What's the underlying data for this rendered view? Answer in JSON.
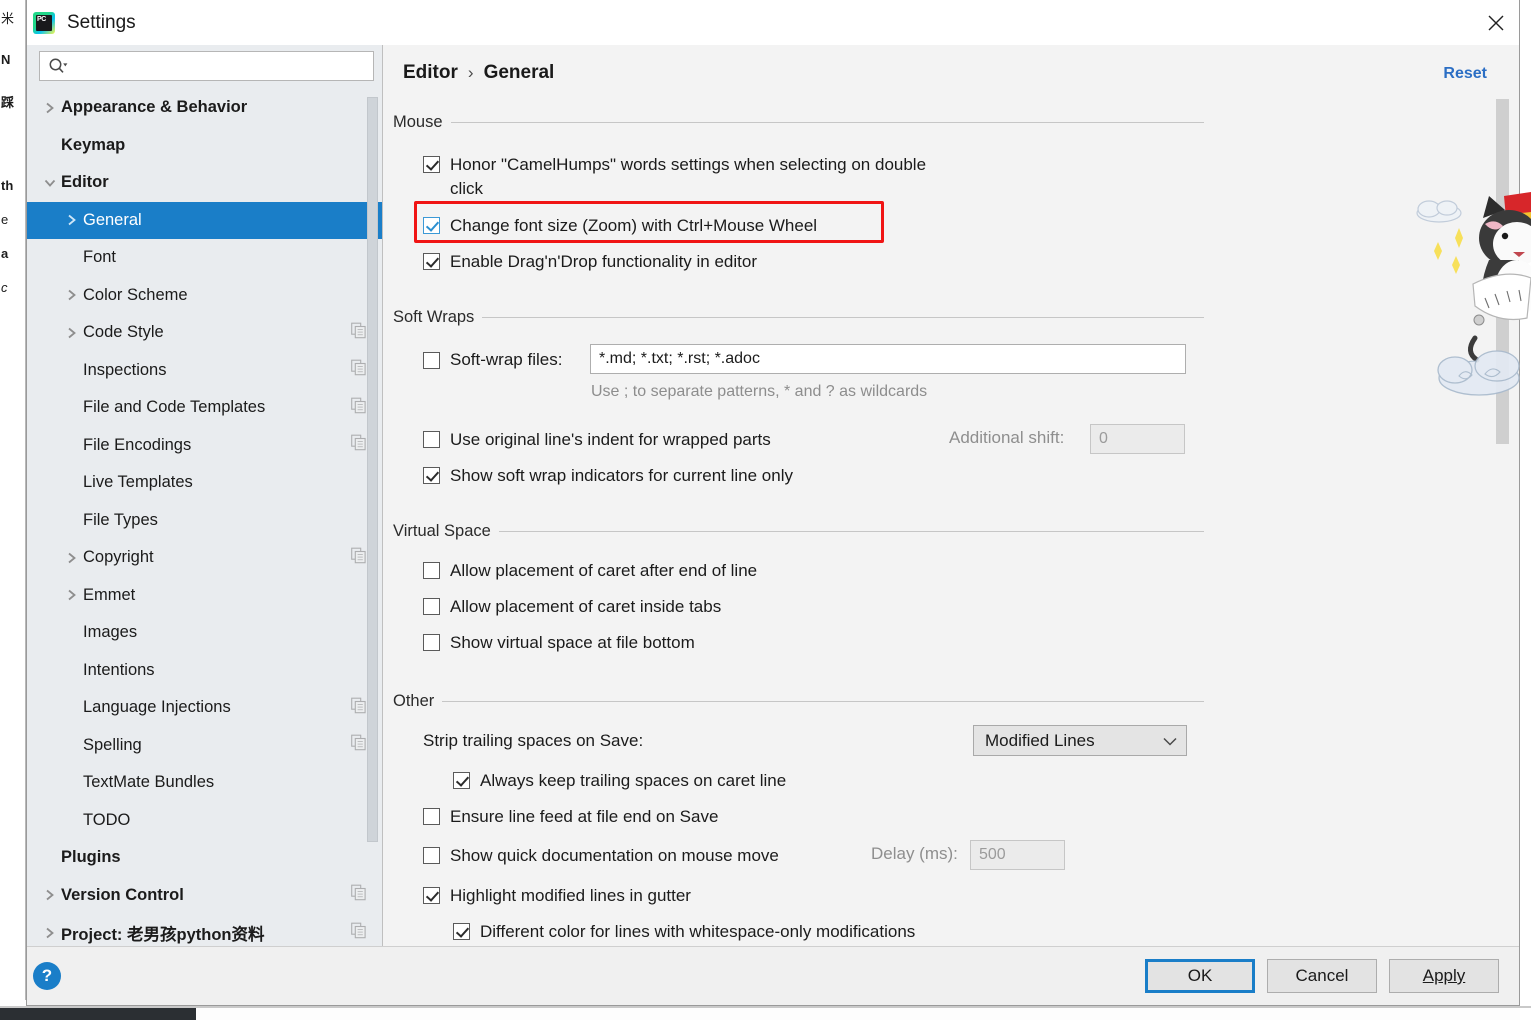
{
  "window": {
    "title": "Settings",
    "logo_text": "PC",
    "close_icon": "close-icon"
  },
  "sidebar": {
    "search": {
      "placeholder": "",
      "value": "",
      "icon": "search-icon"
    },
    "items": [
      {
        "label": "Appearance & Behavior",
        "level": 0,
        "bold": true,
        "arrow": "right",
        "selected": false,
        "copy": false
      },
      {
        "label": "Keymap",
        "level": 0,
        "bold": true,
        "arrow": "none",
        "selected": false,
        "copy": false
      },
      {
        "label": "Editor",
        "level": 0,
        "bold": true,
        "arrow": "down",
        "selected": false,
        "copy": false
      },
      {
        "label": "General",
        "level": 1,
        "bold": false,
        "arrow": "right",
        "selected": true,
        "copy": false
      },
      {
        "label": "Font",
        "level": 1,
        "bold": false,
        "arrow": "none",
        "selected": false,
        "copy": false
      },
      {
        "label": "Color Scheme",
        "level": 1,
        "bold": false,
        "arrow": "right",
        "selected": false,
        "copy": false
      },
      {
        "label": "Code Style",
        "level": 1,
        "bold": false,
        "arrow": "right",
        "selected": false,
        "copy": true
      },
      {
        "label": "Inspections",
        "level": 1,
        "bold": false,
        "arrow": "none",
        "selected": false,
        "copy": true
      },
      {
        "label": "File and Code Templates",
        "level": 1,
        "bold": false,
        "arrow": "none",
        "selected": false,
        "copy": true
      },
      {
        "label": "File Encodings",
        "level": 1,
        "bold": false,
        "arrow": "none",
        "selected": false,
        "copy": true
      },
      {
        "label": "Live Templates",
        "level": 1,
        "bold": false,
        "arrow": "none",
        "selected": false,
        "copy": false
      },
      {
        "label": "File Types",
        "level": 1,
        "bold": false,
        "arrow": "none",
        "selected": false,
        "copy": false
      },
      {
        "label": "Copyright",
        "level": 1,
        "bold": false,
        "arrow": "right",
        "selected": false,
        "copy": true
      },
      {
        "label": "Emmet",
        "level": 1,
        "bold": false,
        "arrow": "right",
        "selected": false,
        "copy": false
      },
      {
        "label": "Images",
        "level": 1,
        "bold": false,
        "arrow": "none",
        "selected": false,
        "copy": false
      },
      {
        "label": "Intentions",
        "level": 1,
        "bold": false,
        "arrow": "none",
        "selected": false,
        "copy": false
      },
      {
        "label": "Language Injections",
        "level": 1,
        "bold": false,
        "arrow": "none",
        "selected": false,
        "copy": true
      },
      {
        "label": "Spelling",
        "level": 1,
        "bold": false,
        "arrow": "none",
        "selected": false,
        "copy": true
      },
      {
        "label": "TextMate Bundles",
        "level": 1,
        "bold": false,
        "arrow": "none",
        "selected": false,
        "copy": false
      },
      {
        "label": "TODO",
        "level": 1,
        "bold": false,
        "arrow": "none",
        "selected": false,
        "copy": false
      },
      {
        "label": "Plugins",
        "level": 0,
        "bold": true,
        "arrow": "none",
        "selected": false,
        "copy": false
      },
      {
        "label": "Version Control",
        "level": 0,
        "bold": true,
        "arrow": "right",
        "selected": false,
        "copy": true
      },
      {
        "label": "Project: 老男孩python资料",
        "level": 0,
        "bold": true,
        "arrow": "right",
        "selected": false,
        "copy": true
      }
    ]
  },
  "panel": {
    "breadcrumb": {
      "parent": "Editor",
      "separator": "›",
      "current": "General"
    },
    "reset_label": "Reset",
    "groups": {
      "mouse": {
        "title": "Mouse",
        "honor_camelhumps": {
          "label": "Honor \"CamelHumps\" words settings when selecting on double click",
          "checked": true
        },
        "change_font_size": {
          "label": "Change font size (Zoom) with Ctrl+Mouse Wheel",
          "checked": true,
          "highlighted": true
        },
        "drag_n_drop": {
          "label": "Enable Drag'n'Drop functionality in editor",
          "checked": true
        }
      },
      "soft_wraps": {
        "title": "Soft Wraps",
        "soft_wrap_files": {
          "label": "Soft-wrap files:",
          "checked": false,
          "value": "*.md; *.txt; *.rst; *.adoc"
        },
        "hint": "Use ; to separate patterns, * and ? as wildcards",
        "original_indent": {
          "label": "Use original line's indent for wrapped parts",
          "checked": false
        },
        "additional_shift": {
          "label": "Additional shift:",
          "value": "0",
          "disabled": true
        },
        "show_indicators": {
          "label": "Show soft wrap indicators for current line only",
          "checked": true
        }
      },
      "virtual_space": {
        "title": "Virtual Space",
        "caret_after_eol": {
          "label": "Allow placement of caret after end of line",
          "checked": false
        },
        "caret_inside_tabs": {
          "label": "Allow placement of caret inside tabs",
          "checked": false
        },
        "virtual_space_bottom": {
          "label": "Show virtual space at file bottom",
          "checked": false
        }
      },
      "other": {
        "title": "Other",
        "strip_trailing": {
          "label": "Strip trailing spaces on Save:",
          "value": "Modified Lines"
        },
        "always_keep": {
          "label": "Always keep trailing spaces on caret line",
          "checked": true
        },
        "ensure_line_feed": {
          "label": "Ensure line feed at file end on Save",
          "checked": false
        },
        "quick_doc": {
          "label": "Show quick documentation on mouse move",
          "checked": false
        },
        "delay": {
          "label": "Delay (ms):",
          "value": "500",
          "disabled": true
        },
        "highlight_modified": {
          "label": "Highlight modified lines in gutter",
          "checked": true
        },
        "different_color": {
          "label": "Different color for lines with whitespace-only modifications",
          "checked": true
        }
      }
    }
  },
  "footer": {
    "help_label": "?",
    "ok_label": "OK",
    "cancel_label": "Cancel",
    "apply_label": "Apply"
  },
  "colors": {
    "accent": "#1a7ec8",
    "selection": "#1a7ec8",
    "highlight": "#f01414",
    "link": "#2b6ec4"
  }
}
